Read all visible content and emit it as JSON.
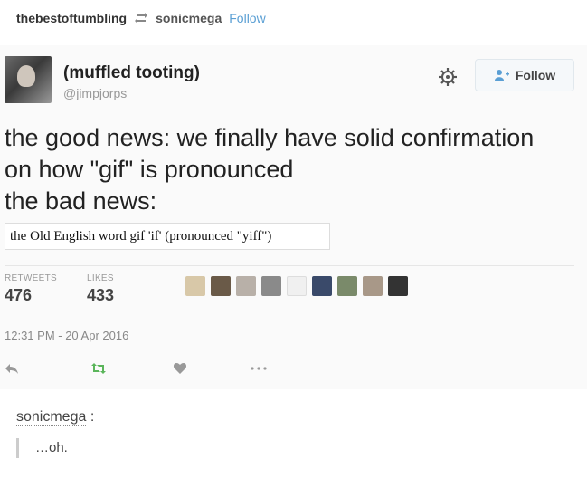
{
  "reblog": {
    "source_user": "thebestoftumbling",
    "reblogger": "sonicmega",
    "follow_label": "Follow"
  },
  "tweet": {
    "display_name": "(muffled tooting)",
    "handle": "@jimpjorps",
    "follow_label": "Follow",
    "text_lines": [
      "the good news: we finally have solid confirmation",
      "on how \"gif\" is pronounced",
      "the bad news:"
    ],
    "embed_text": "the Old English word gif 'if' (pronounced \"yiff\")",
    "retweets_label": "RETWEETS",
    "retweets": "476",
    "likes_label": "LIKES",
    "likes": "433",
    "timestamp": "12:31 PM - 20 Apr 2016",
    "icons": {
      "reply": "reply-icon",
      "retweet": "retweet-icon",
      "like": "heart-icon",
      "more": "more-icon",
      "settings": "gear-icon"
    }
  },
  "reply": {
    "author": "sonicmega",
    "separator": ":",
    "text": "…oh."
  },
  "colors": {
    "accent": "#5a9fd4",
    "retweet_green": "#5ab55a",
    "muted": "#999999"
  }
}
